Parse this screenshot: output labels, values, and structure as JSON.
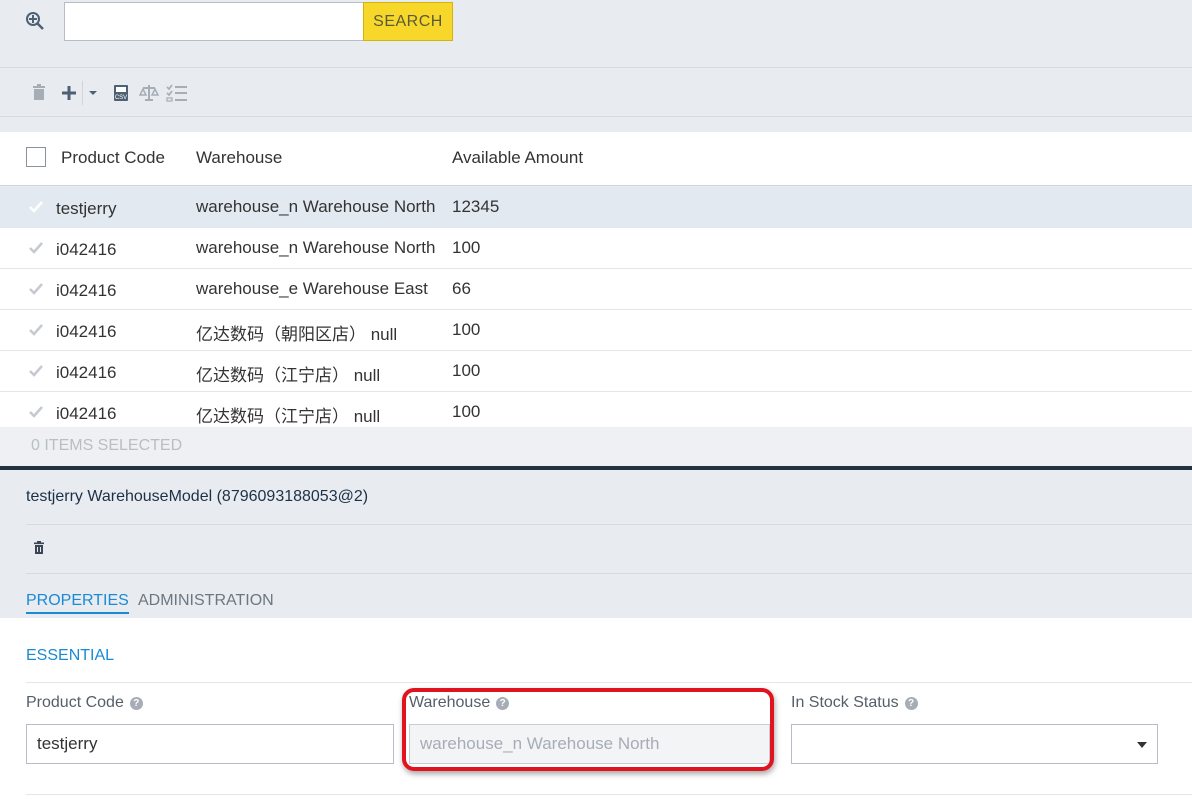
{
  "search": {
    "button_label": "SEARCH",
    "value": ""
  },
  "table": {
    "headers": [
      "Product Code",
      "Warehouse",
      "Available Amount"
    ],
    "rows": [
      {
        "code": "testjerry",
        "warehouse": "warehouse_n Warehouse North",
        "amount": "12345",
        "selected": true
      },
      {
        "code": "i042416",
        "warehouse": "warehouse_n Warehouse North",
        "amount": "100"
      },
      {
        "code": "i042416",
        "warehouse": "warehouse_e Warehouse East",
        "amount": "66"
      },
      {
        "code": "i042416",
        "warehouse": "亿达数码（朝阳区店） null",
        "amount": "100"
      },
      {
        "code": "i042416",
        "warehouse": "亿达数码（江宁店） null",
        "amount": "100"
      },
      {
        "code": "i042416",
        "warehouse": "亿达数码（江宁店） null",
        "amount": "100"
      }
    ],
    "status": "0 ITEMS SELECTED"
  },
  "editor": {
    "title": "testjerry WarehouseModel (8796093188053@2)",
    "tabs": [
      "PROPERTIES",
      "ADMINISTRATION"
    ],
    "section": "ESSENTIAL",
    "fields": {
      "product_code_label": "Product Code",
      "product_code_value": "testjerry",
      "warehouse_label": "Warehouse",
      "warehouse_value": "warehouse_n Warehouse North",
      "stock_label": "In Stock Status",
      "stock_value": ""
    }
  },
  "colors": {
    "accent": "#1a8ad4",
    "search_button": "#f7d72a",
    "highlight": "#e0141e",
    "header_bar": "#233140"
  }
}
